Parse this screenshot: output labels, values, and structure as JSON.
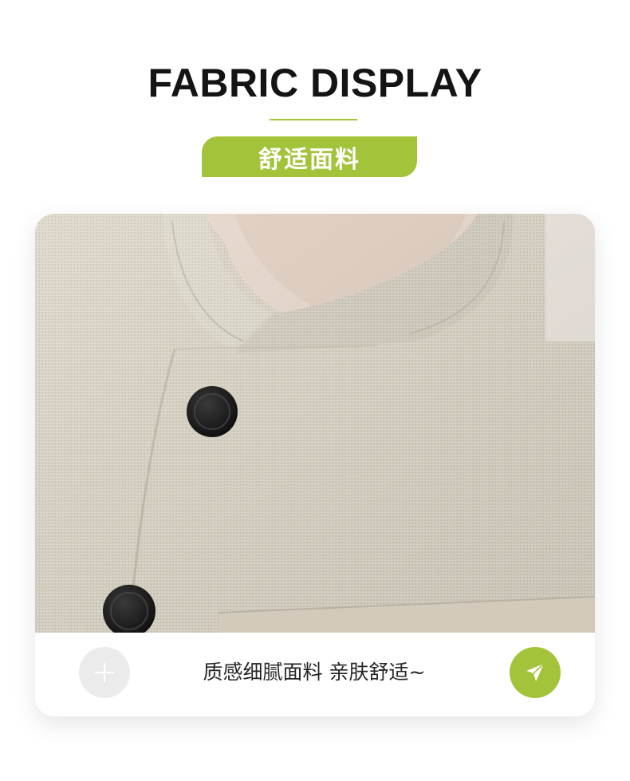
{
  "header": {
    "title": "FABRIC DISPLAY",
    "tag": "舒适面料"
  },
  "card": {
    "caption": "质感细腻面料 亲肤舒适~",
    "plus_icon": "plus-icon",
    "send_icon": "paper-plane-icon"
  },
  "colors": {
    "accent": "#a3c43a",
    "fabric": "#dcd6c8",
    "button": "#1c1c1c"
  }
}
